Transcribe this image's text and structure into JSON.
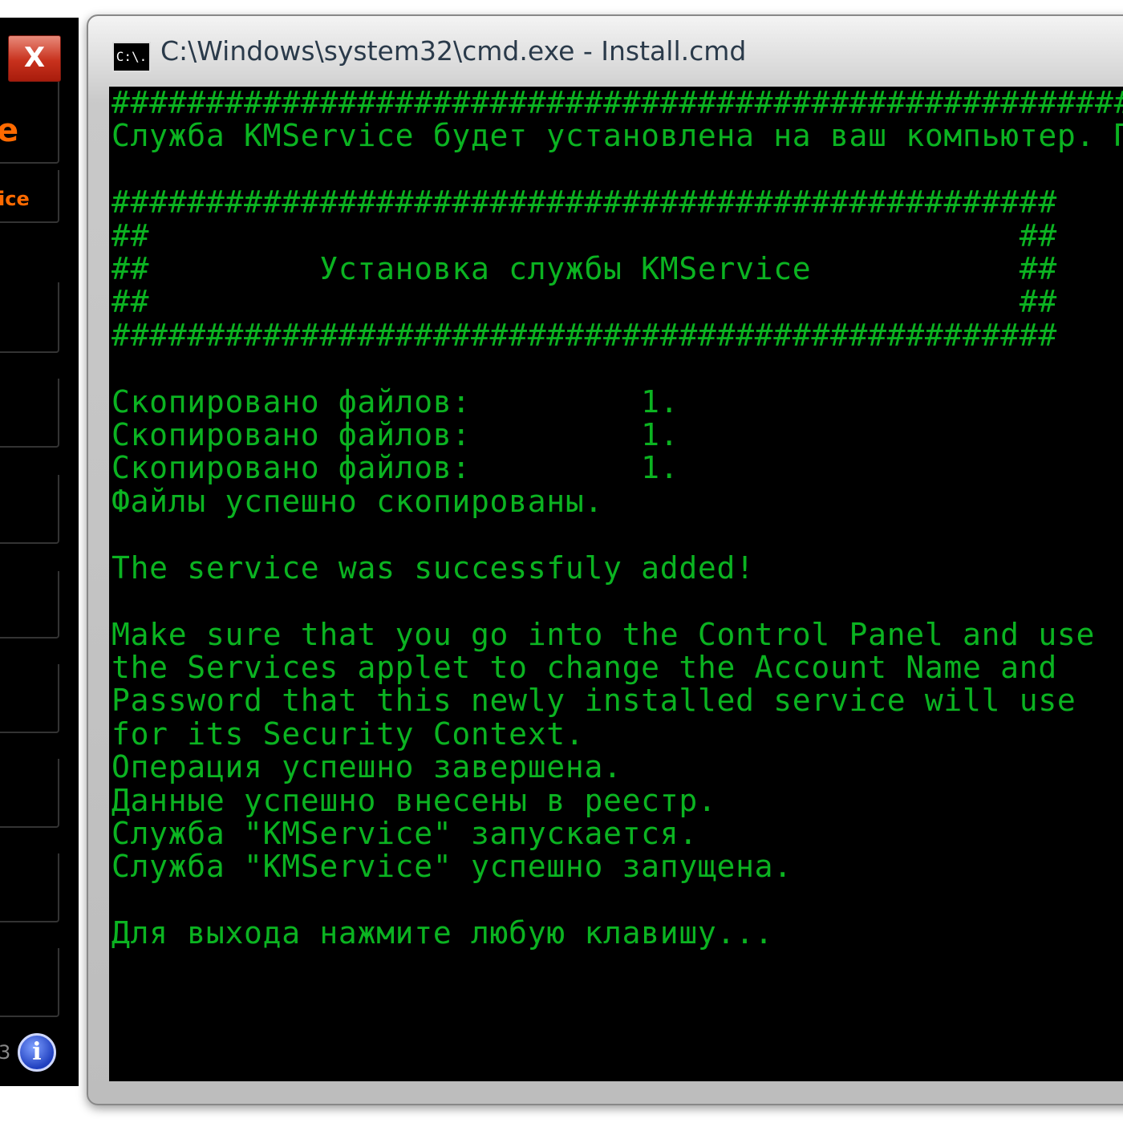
{
  "left_panel": {
    "close_label": "X",
    "fragment_top": "e",
    "fragment_second": "ice",
    "version_fragment": "3",
    "info_icon": "info-icon"
  },
  "window": {
    "title": "C:\\Windows\\system32\\cmd.exe - Install.cmd",
    "icon": "cmd-icon",
    "icon_text": "C:\\."
  },
  "console": {
    "text_color": "#0bb321",
    "lines": [
      "##################################################################",
      "Служба KMService будет установлена на ваш компьютер. П",
      "",
      "##################################################",
      "##                                              ##",
      "##         Установка службы KMService           ##",
      "##                                              ##",
      "##################################################",
      "",
      "Скопировано файлов:         1.",
      "Скопировано файлов:         1.",
      "Скопировано файлов:         1.",
      "Файлы успешно скопированы.",
      "",
      "The service was successfuly added!",
      "",
      "Make sure that you go into the Control Panel and use",
      "the Services applet to change the Account Name and",
      "Password that this newly installed service will use",
      "for its Security Context.",
      "Операция успешно завершена.",
      "Данные успешно внесены в реестр.",
      "Служба \"KMService\" запускается.",
      "Служба \"KMService\" успешно запущена.",
      "",
      "Для выхода нажмите любую клавишу..."
    ]
  }
}
